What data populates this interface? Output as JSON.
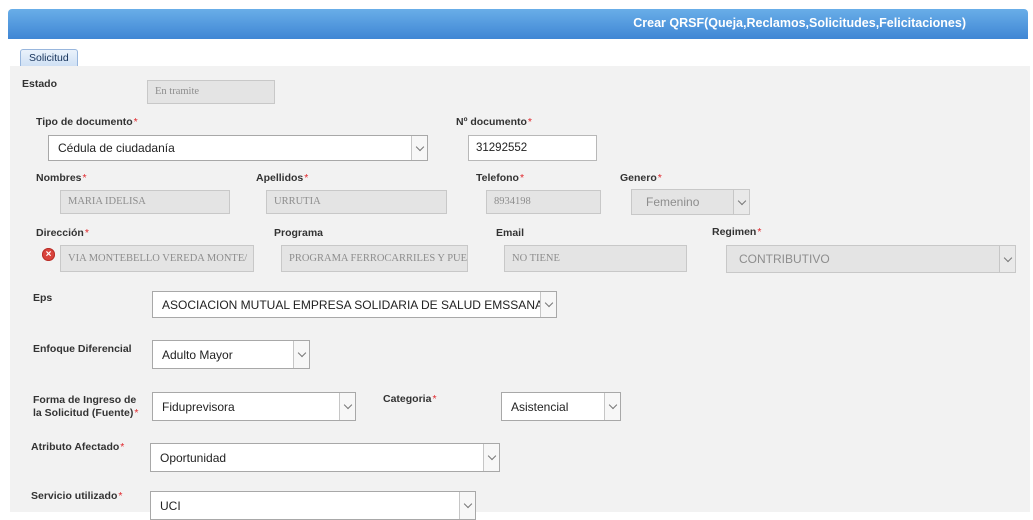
{
  "window": {
    "title": "Crear QRSF(Queja,Reclamos,Solicitudes,Felicitaciones)"
  },
  "tabs": [
    {
      "label": "Solicitud"
    }
  ],
  "required_marker": "*",
  "form": {
    "estado": {
      "label": "Estado",
      "value": "En tramite"
    },
    "tipo_documento": {
      "label": "Tipo de documento",
      "value": "Cédula de ciudadanía"
    },
    "numero_documento": {
      "label": "Nº documento",
      "value": "31292552"
    },
    "nombres": {
      "label": "Nombres",
      "value": "MARIA IDELISA"
    },
    "apellidos": {
      "label": "Apellidos",
      "value": "URRUTIA"
    },
    "telefono": {
      "label": "Telefono",
      "value": "8934198"
    },
    "genero": {
      "label": "Genero",
      "value": "Femenino"
    },
    "direccion": {
      "label": "Dirección",
      "value": "VIA MONTEBELLO VEREDA MONTE/"
    },
    "programa": {
      "label": "Programa",
      "value": "PROGRAMA FERROCARRILES Y PUE"
    },
    "email": {
      "label": "Email",
      "value": "NO TIENE"
    },
    "regimen": {
      "label": "Regimen",
      "value": "CONTRIBUTIVO"
    },
    "eps": {
      "label": "Eps",
      "value": "ASOCIACION MUTUAL EMPRESA SOLIDARIA DE SALUD EMSSANAR ESS"
    },
    "enfoque": {
      "label": "Enfoque Diferencial",
      "value": "Adulto Mayor"
    },
    "forma_ingreso": {
      "label_line1": "Forma de Ingreso de",
      "label_line2": "la Solicitud (Fuente)",
      "value": "Fiduprevisora"
    },
    "categoria": {
      "label": "Categoria",
      "value": "Asistencial"
    },
    "atributo": {
      "label": "Atributo Afectado",
      "value": "Oportunidad"
    },
    "servicio": {
      "label": "Servicio utilizado",
      "value": "UCI"
    }
  },
  "icons": {
    "error": "error-circle-icon",
    "dropdown": "chevron-down-icon"
  },
  "colors": {
    "header": "#4a90dc",
    "required": "#e0262b",
    "panel": "#f2f2f2",
    "error": "#d9433c"
  }
}
